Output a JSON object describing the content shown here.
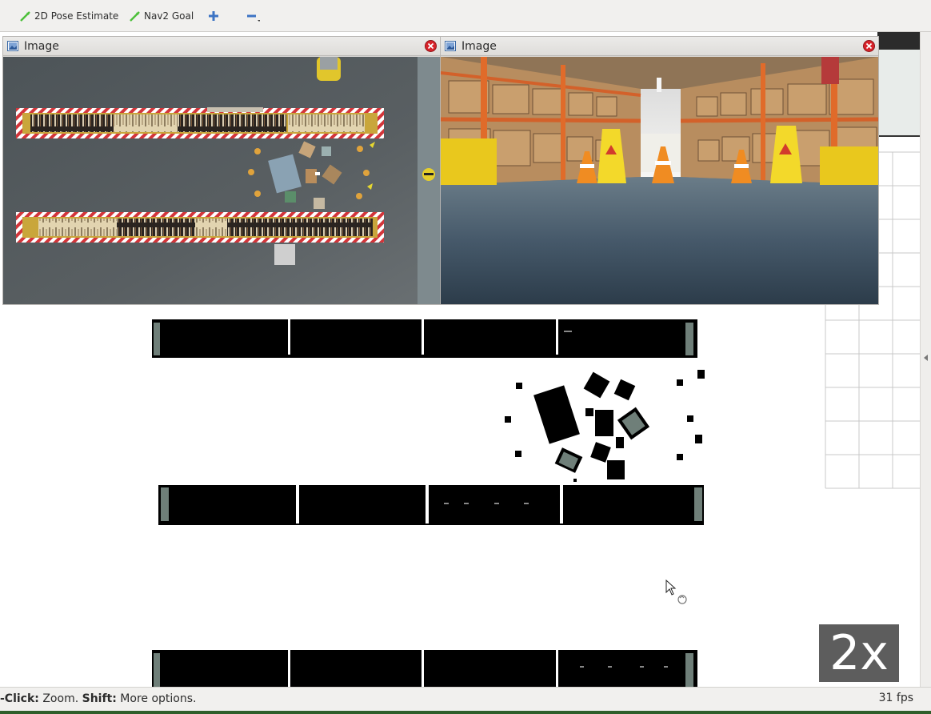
{
  "toolbar": {
    "pose_estimate_label": "2D Pose Estimate",
    "nav_goal_label": "Nav2 Goal",
    "zoom_in_icon": "plus-icon",
    "zoom_out_icon": "minus-icon"
  },
  "panels": [
    {
      "title": "Image",
      "view": "top-down warehouse camera"
    },
    {
      "title": "Image",
      "view": "forward warehouse aisle camera"
    }
  ],
  "status": {
    "click_key": "-Click:",
    "click_action": " Zoom. ",
    "shift_key": "Shift:",
    "shift_action": " More options.",
    "fps": "31 fps"
  },
  "zoom_badge": "2x",
  "colors": {
    "toolbar_bg": "#f1f0ee",
    "map_occupied": "#000000",
    "map_unknown_rim": "#6f7f79",
    "grid_line": "#c8c8c8",
    "close_button": "#d8232a",
    "pen_green": "#4bbf38"
  }
}
